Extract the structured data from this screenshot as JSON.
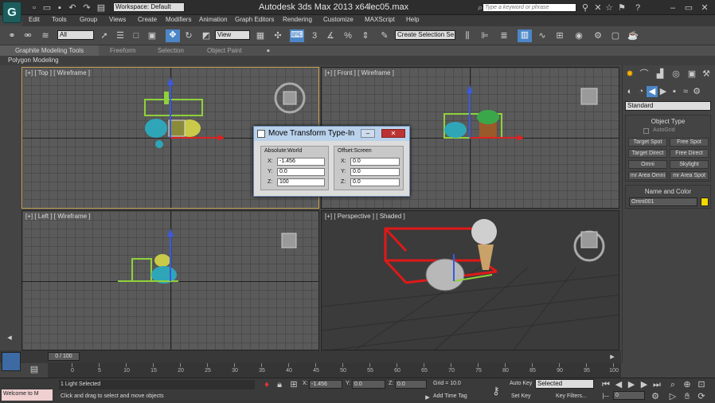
{
  "titlebar": {
    "workspace": "Workspace: Default",
    "app_title": "Autodesk 3ds Max  2013 x64",
    "filename": "lec05.max",
    "search_placeholder": "Type a keyword or phrase"
  },
  "menu": [
    "Edit",
    "Tools",
    "Group",
    "Views",
    "Create",
    "Modifiers",
    "Animation",
    "Graph Editors",
    "Rendering",
    "Customize",
    "MAXScript",
    "Help"
  ],
  "toolbar": {
    "selection_filter": "All",
    "ref_coord": "View",
    "named_sel": "Create Selection Se"
  },
  "ribbon": {
    "tabs": [
      "Graphite Modeling Tools",
      "Freeform",
      "Selection",
      "Object Paint"
    ],
    "subtab": "Polygon Modeling"
  },
  "viewports": {
    "top": "[+] [ Top ] [ Wireframe ]",
    "front": "[+] [ Front ] [ Wireframe ]",
    "left": "[+] [ Left ] [ Wireframe ]",
    "persp": "[+] [ Perspective ] [ Shaded ]"
  },
  "dialog": {
    "title": "Move Transform Type-In",
    "abs_label": "Absolute:World",
    "off_label": "Offset:Screen",
    "abs": {
      "x": "-1.456",
      "y": "0.0",
      "z": "100"
    },
    "off": {
      "x": "0.0",
      "y": "0.0",
      "z": "0.0"
    }
  },
  "cmdpanel": {
    "dropdown": "Standard",
    "object_type": "Object Type",
    "autogrid": "AutoGrid",
    "buttons": [
      "Target Spot",
      "Free Spot",
      "Target Direct",
      "Free Direct",
      "Omni",
      "Skylight",
      "mr Area Omni",
      "mr Area Spot"
    ],
    "name_color": "Name and Color",
    "name_value": "Omni001",
    "name_color_hex": "#f5d800"
  },
  "timeline": {
    "frame": "0 / 100",
    "ticks": [
      "0",
      "5",
      "10",
      "15",
      "20",
      "25",
      "30",
      "35",
      "40",
      "45",
      "50",
      "55",
      "60",
      "65",
      "70",
      "75",
      "80",
      "85",
      "90",
      "95",
      "100"
    ]
  },
  "status": {
    "maxscript": "Welcome to M",
    "selected": "1 Light Selected",
    "prompt": "Click and drag to select and move objects",
    "x": "-1.456",
    "y": "0.0",
    "z": "0.0",
    "grid": "Grid = 10.0",
    "add_time_tag": "Add Time Tag",
    "autokey": "Auto Key",
    "autokey_sel": "Selected",
    "setkey": "Set Key",
    "keyfilters": "Key Filters...",
    "frame_field": "0"
  }
}
